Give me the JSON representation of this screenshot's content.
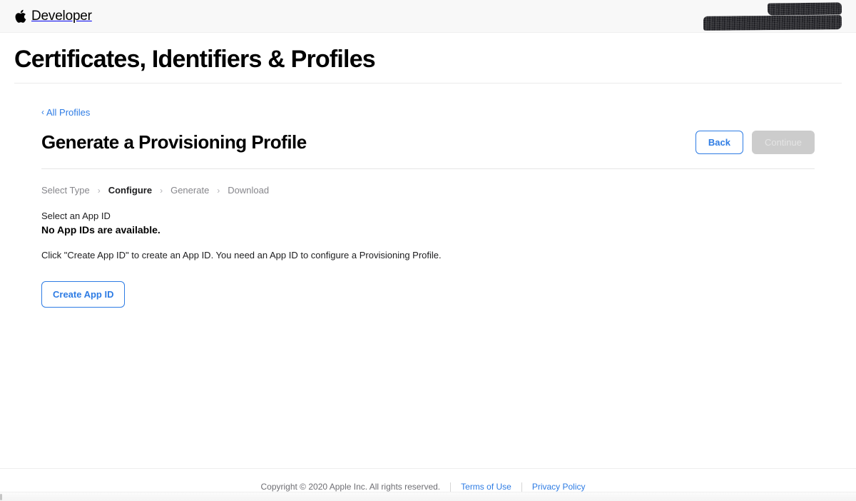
{
  "globalnav": {
    "apple_logo_icon": "apple-logo-icon",
    "brand": "Developer",
    "redacted_label": "redacted account name"
  },
  "page": {
    "title": "Certificates, Identifiers & Profiles"
  },
  "breadcrumb": {
    "chevron": "‹",
    "back_label": "All Profiles"
  },
  "section": {
    "title": "Generate a Provisioning Profile",
    "back_button": "Back",
    "continue_button": "Continue"
  },
  "steps": {
    "separator": "›",
    "items": [
      {
        "label": "Select Type",
        "state": "done"
      },
      {
        "label": "Configure",
        "state": "current"
      },
      {
        "label": "Generate",
        "state": "upcoming"
      },
      {
        "label": "Download",
        "state": "upcoming"
      }
    ]
  },
  "main": {
    "select_label": "Select an App ID",
    "empty_state": "No App IDs are available.",
    "help_text": "Click \"Create App ID\" to create an App ID. You need an App ID to configure a Provisioning Profile.",
    "create_button": "Create App ID"
  },
  "footer": {
    "copyright": "Copyright © 2020 Apple Inc. All rights reserved.",
    "terms_link": "Terms of Use",
    "privacy_link": "Privacy Policy"
  },
  "colors": {
    "accent_blue": "#2e7ce4",
    "disabled_gray": "#cccccc",
    "nav_background": "#f8f8f8",
    "muted_text": "#86868b"
  }
}
